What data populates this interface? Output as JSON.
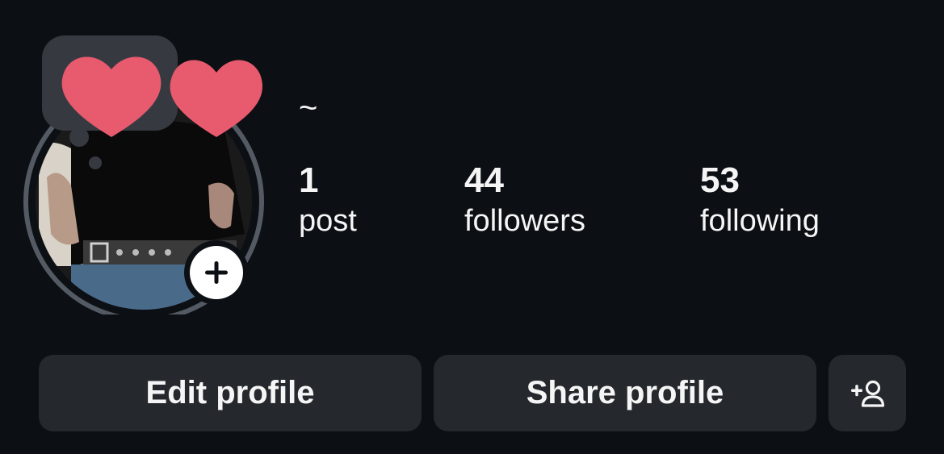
{
  "profile": {
    "display_name": "~",
    "avatar_icon": "profile-photo-with-heart-stickers",
    "add_story_icon": "plus-icon",
    "ring_color": "#545a63",
    "heart_color": "#e85a6e"
  },
  "stats": {
    "posts": {
      "count": "1",
      "label": "post"
    },
    "followers": {
      "count": "44",
      "label": "followers"
    },
    "following": {
      "count": "53",
      "label": "following"
    }
  },
  "actions": {
    "edit_profile_label": "Edit profile",
    "share_profile_label": "Share profile",
    "discover_people_icon": "add-person-icon"
  },
  "colors": {
    "background": "#0c1014",
    "button_bg": "#25292e",
    "text": "#f5f5f5"
  }
}
